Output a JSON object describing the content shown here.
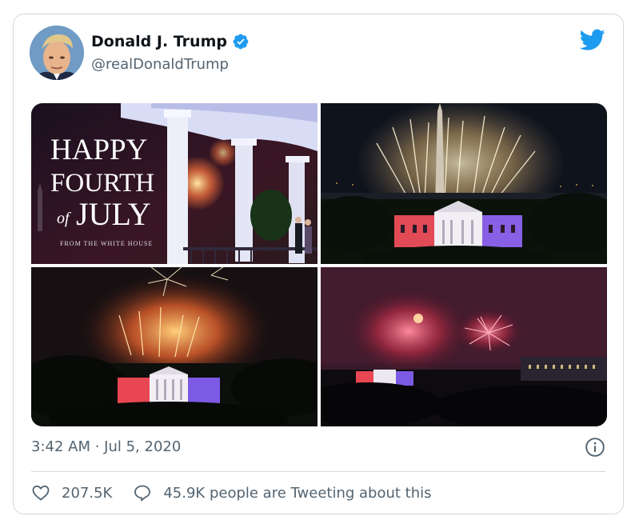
{
  "tweet": {
    "author_name": "Donald J. Trump",
    "author_handle": "@realDonaldTrump",
    "timestamp": "3:42 AM · Jul 5, 2020",
    "likes": "207.5K",
    "tweeting_text": "45.9K people are Tweeting about this"
  },
  "media": {
    "banner": {
      "line1": "HAPPY",
      "line2": "FOURTH",
      "line3_small": "of",
      "line3": "JULY",
      "caption": "FROM THE WHITE HOUSE"
    }
  },
  "icons": {
    "verified": "verified-badge-icon",
    "logo": "twitter-bird-icon",
    "info": "info-icon",
    "like": "heart-icon",
    "reply": "speech-bubble-icon"
  },
  "colors": {
    "brand_blue": "#1d9bf0",
    "secondary_text": "#536471",
    "border": "#cfd9de"
  }
}
